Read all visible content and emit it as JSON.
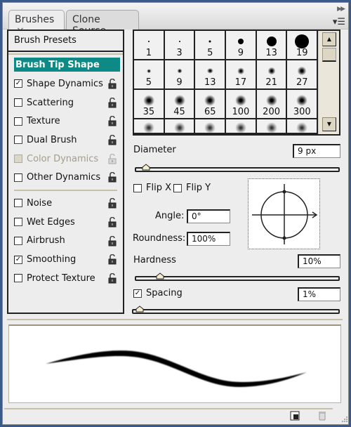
{
  "tabs": [
    {
      "label": "Brushes",
      "close": "×",
      "active": true
    },
    {
      "label": "Clone Source",
      "active": false
    }
  ],
  "panel_icons": {
    "collapse": "double-arrow-right-icon",
    "menu": "panel-menu-icon"
  },
  "sidebar": {
    "preset_label": "Brush Presets",
    "group1": [
      {
        "label": "Brush Tip Shape",
        "selected": true,
        "has_checkbox": false
      },
      {
        "label": "Shape Dynamics",
        "checked": true,
        "locked": false
      },
      {
        "label": "Scattering",
        "checked": false,
        "locked": false
      },
      {
        "label": "Texture",
        "checked": false,
        "locked": false
      },
      {
        "label": "Dual Brush",
        "checked": false,
        "locked": false
      },
      {
        "label": "Color Dynamics",
        "checked": false,
        "disabled": true
      },
      {
        "label": "Other Dynamics",
        "checked": false,
        "locked": false
      }
    ],
    "group2": [
      {
        "label": "Noise",
        "checked": false
      },
      {
        "label": "Wet Edges",
        "checked": false
      },
      {
        "label": "Airbrush",
        "checked": false
      },
      {
        "label": "Smoothing",
        "checked": true
      },
      {
        "label": "Protect Texture",
        "checked": false
      }
    ]
  },
  "brush_tips": [
    {
      "size": "1",
      "type": "hard"
    },
    {
      "size": "3",
      "type": "hard"
    },
    {
      "size": "5",
      "type": "hard"
    },
    {
      "size": "9",
      "type": "hard"
    },
    {
      "size": "13",
      "type": "hard"
    },
    {
      "size": "19",
      "type": "hard"
    },
    {
      "size": "5",
      "type": "soft"
    },
    {
      "size": "9",
      "type": "soft"
    },
    {
      "size": "13",
      "type": "soft"
    },
    {
      "size": "17",
      "type": "soft"
    },
    {
      "size": "21",
      "type": "soft"
    },
    {
      "size": "27",
      "type": "soft"
    },
    {
      "size": "35",
      "type": "soft"
    },
    {
      "size": "45",
      "type": "soft"
    },
    {
      "size": "65",
      "type": "soft"
    },
    {
      "size": "100",
      "type": "soft"
    },
    {
      "size": "200",
      "type": "soft"
    },
    {
      "size": "300",
      "type": "soft"
    },
    {
      "size": "",
      "type": "scatter"
    },
    {
      "size": "",
      "type": "scatter"
    },
    {
      "size": "",
      "type": "scatter"
    },
    {
      "size": "",
      "type": "scatter"
    },
    {
      "size": "",
      "type": "scatter"
    },
    {
      "size": "",
      "type": "scatter"
    }
  ],
  "controls": {
    "diameter_label": "Diameter",
    "diameter_value": "9 px",
    "diameter_slider": 0.03,
    "flip_x_label": "Flip X",
    "flip_y_label": "Flip Y",
    "flip_x": false,
    "flip_y": false,
    "angle_label": "Angle:",
    "angle_value": "0°",
    "roundness_label": "Roundness:",
    "roundness_value": "100%",
    "hardness_label": "Hardness",
    "hardness_value": "10%",
    "hardness_slider": 0.1,
    "spacing_label": "Spacing",
    "spacing_checked": true,
    "spacing_value": "1%",
    "spacing_slider": 0.01
  },
  "footer": {
    "new_icon": "new-preset-icon",
    "delete_icon": "trash-icon",
    "resize_icon": "resize-grip-icon"
  }
}
